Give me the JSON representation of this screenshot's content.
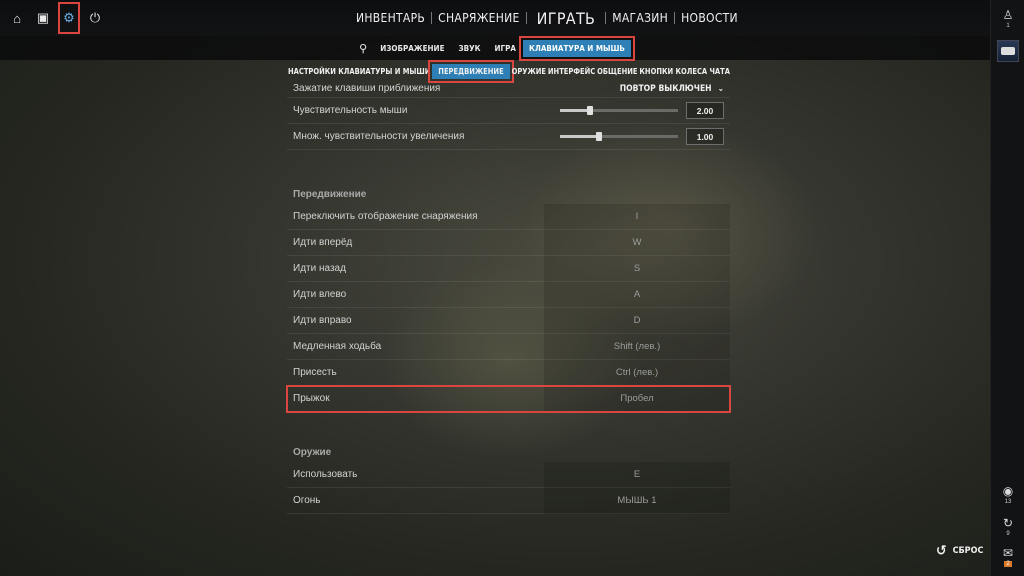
{
  "top_icons": [
    {
      "name": "home-icon",
      "glyph": "⌂"
    },
    {
      "name": "tv-icon",
      "glyph": "▣"
    },
    {
      "name": "gear-icon",
      "glyph": "⚙"
    },
    {
      "name": "power-icon",
      "glyph": "⏻"
    }
  ],
  "main_nav": {
    "inventory": "ИНВЕНТАРЬ",
    "loadout": "СНАРЯЖЕНИЕ",
    "play": "ИГРАТЬ",
    "store": "МАГАЗИН",
    "news": "НОВОСТИ"
  },
  "sub_nav": [
    "ИЗОБРАЖЕНИЕ",
    "ЗВУК",
    "ИГРА",
    "КЛАВИАТУРА И МЫШЬ"
  ],
  "cat_nav": [
    "НАСТРОЙКИ КЛАВИАТУРЫ И МЫШИ",
    "ПЕРЕДВИЖЕНИЕ",
    "ОРУЖИЕ",
    "ИНТЕРФЕЙС",
    "ОБЩЕНИЕ",
    "КНОПКИ КОЛЕСА ЧАТА"
  ],
  "settings": {
    "zoom_hold_label": "Зажатие клавиши приближения",
    "zoom_hold_value": "ПОВТОР ВЫКЛЮЧЕН",
    "mouse_sens_label": "Чувствительность мыши",
    "mouse_sens_value": "2.00",
    "mouse_sens_level": 0.25,
    "zoom_sens_label": "Множ. чувствительности увеличения",
    "zoom_sens_value": "1.00",
    "zoom_sens_level": 0.33
  },
  "movement": {
    "title": "Передвижение",
    "rows": [
      {
        "label": "Переключить отображение снаряжения",
        "key": "I"
      },
      {
        "label": "Идти вперёд",
        "key": "W"
      },
      {
        "label": "Идти назад",
        "key": "S"
      },
      {
        "label": "Идти влево",
        "key": "A"
      },
      {
        "label": "Идти вправо",
        "key": "D"
      },
      {
        "label": "Медленная ходьба",
        "key": "Shift (лев.)"
      },
      {
        "label": "Присесть",
        "key": "Ctrl (лев.)"
      },
      {
        "label": "Прыжок",
        "key": "Пробел"
      }
    ]
  },
  "weapons": {
    "title": "Оружие",
    "rows": [
      {
        "label": "Использовать",
        "key": "E"
      },
      {
        "label": "Огонь",
        "key": "МЫШЬ 1"
      }
    ]
  },
  "rail": {
    "profile_count": "1",
    "signal_count": "13",
    "history_count": "9",
    "mail_count": "2"
  },
  "reset_label": "СБРОС"
}
